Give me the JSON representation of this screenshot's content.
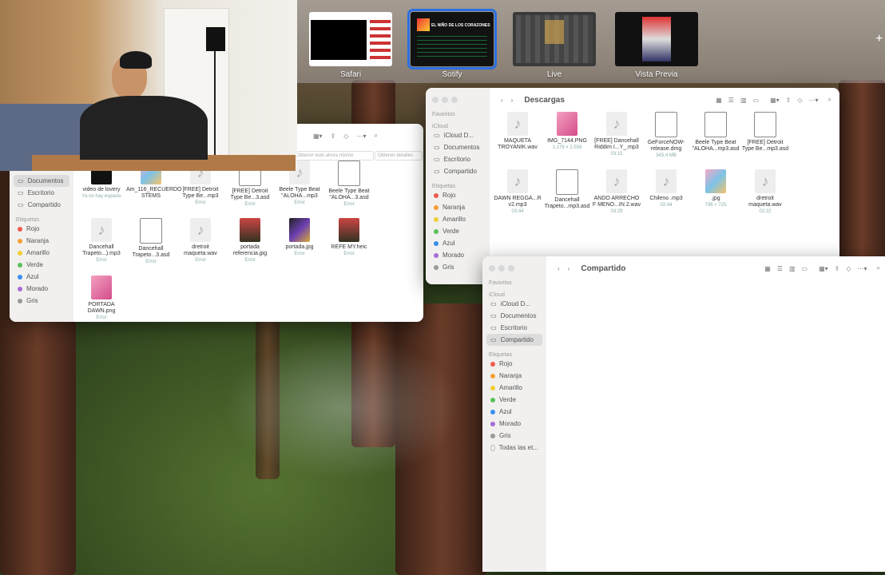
{
  "switcher": {
    "apps": [
      {
        "label": "Safari"
      },
      {
        "label": "Sotify"
      },
      {
        "label": "Live"
      },
      {
        "label": "Vista Previa"
      }
    ],
    "spotify_thumb_title": "EL NIÑO DE LOS CORAZONES"
  },
  "left_finder": {
    "toolbar": {
      "search_hint": "Obtener todo ahora mismo",
      "details": "Obtener detalles"
    },
    "sidebar": {
      "items": [
        "Documentos",
        "Escritorio",
        "Compartido"
      ],
      "tags_header": "Etiquetas",
      "tags": [
        {
          "label": "Rojo",
          "color": "#f05a4f"
        },
        {
          "label": "Naranja",
          "color": "#f5a033"
        },
        {
          "label": "Amarillo",
          "color": "#f2cf33"
        },
        {
          "label": "Verde",
          "color": "#5ac05a"
        },
        {
          "label": "Azul",
          "color": "#3a8df0"
        },
        {
          "label": "Morado",
          "color": "#a76bd6"
        },
        {
          "label": "Gris",
          "color": "#999999"
        }
      ]
    },
    "files": [
      {
        "name": "video de lovery",
        "sub": "Ya no hay espacio"
      },
      {
        "name": "Am_116_RECUERDO STEMS",
        "sub": ""
      },
      {
        "name": "[FREE] Detroit Type Be...mp3",
        "sub": "Error"
      },
      {
        "name": "[FREE] Detroit Type Be...3.asd",
        "sub": "Error"
      },
      {
        "name": "Beele Type Beat \"ALOHA...mp3",
        "sub": "Error"
      },
      {
        "name": "Beele Type Beat \"ALOHA...3.asd",
        "sub": "Error"
      },
      {
        "name": "Dancehall Trapeto...).mp3",
        "sub": "Error"
      },
      {
        "name": "Dancehall Trapeto...3.asd",
        "sub": "Error"
      },
      {
        "name": "dretroit maqueta.wav",
        "sub": "Error"
      },
      {
        "name": "portada referencia.jpg",
        "sub": "Error"
      },
      {
        "name": "portada.jpg",
        "sub": "Error"
      },
      {
        "name": "REFE MY.heic",
        "sub": "Error"
      },
      {
        "name": "PORTADA DAWN.png",
        "sub": "Error"
      }
    ]
  },
  "descargas": {
    "title": "Descargas",
    "sidebar": {
      "favorites_header": "Favoritos",
      "icloud_header": "iCloud",
      "items": [
        "iCloud D...",
        "Documentos",
        "Escritorio",
        "Compartido"
      ],
      "tags_header": "Etiquetas",
      "tags": [
        {
          "label": "Rojo",
          "color": "#f05a4f"
        },
        {
          "label": "Naranja",
          "color": "#f5a033"
        },
        {
          "label": "Amarillo",
          "color": "#f2cf33"
        },
        {
          "label": "Verde",
          "color": "#5ac05a"
        },
        {
          "label": "Azul",
          "color": "#3a8df0"
        },
        {
          "label": "Morado",
          "color": "#a76bd6"
        },
        {
          "label": "Gris",
          "color": "#999999"
        }
      ]
    },
    "files": [
      {
        "name": "MAQUETA TROYANIK.wav",
        "sub": ""
      },
      {
        "name": "IMG_7144.PNG",
        "sub": "1.179 × 2.556"
      },
      {
        "name": "[FREE] Dancehall Riddim I...Y_.mp3",
        "sub": "03:15"
      },
      {
        "name": "GeForceNOW-release.dmg",
        "sub": "345,4 MB"
      },
      {
        "name": "Beele Type Beat \"ALOHA...mp3.asd",
        "sub": ""
      },
      {
        "name": "[FREE] Detroit Type Be...mp3.asd",
        "sub": ""
      },
      {
        "name": "DAWN REGGA...R v2.mp3",
        "sub": "03:44"
      },
      {
        "name": "Dancehall Trapeto...mp3.asd",
        "sub": ""
      },
      {
        "name": "ANDO ARRECHO F MENO...IN 2.wav",
        "sub": "03:29"
      },
      {
        "name": "Chileno .mp3",
        "sub": "02:44"
      },
      {
        "name": ".jpg",
        "sub": "736 × 725"
      },
      {
        "name": "dretroit maqueta.wav",
        "sub": "02:22"
      }
    ]
  },
  "compartido": {
    "title": "Compartido",
    "sidebar": {
      "favorites_header": "Favoritos",
      "icloud_header": "iCloud",
      "items": [
        "iCloud D...",
        "Documentos",
        "Escritorio",
        "Compartido"
      ],
      "tags_header": "Etiquetas",
      "tags": [
        {
          "label": "Rojo",
          "color": "#f05a4f"
        },
        {
          "label": "Naranja",
          "color": "#f5a033"
        },
        {
          "label": "Amarillo",
          "color": "#f2cf33"
        },
        {
          "label": "Verde",
          "color": "#5ac05a"
        },
        {
          "label": "Azul",
          "color": "#3a8df0"
        },
        {
          "label": "Morado",
          "color": "#a76bd6"
        },
        {
          "label": "Gris",
          "color": "#999999"
        },
        {
          "label": "Todas las et...",
          "color": ""
        }
      ]
    }
  }
}
